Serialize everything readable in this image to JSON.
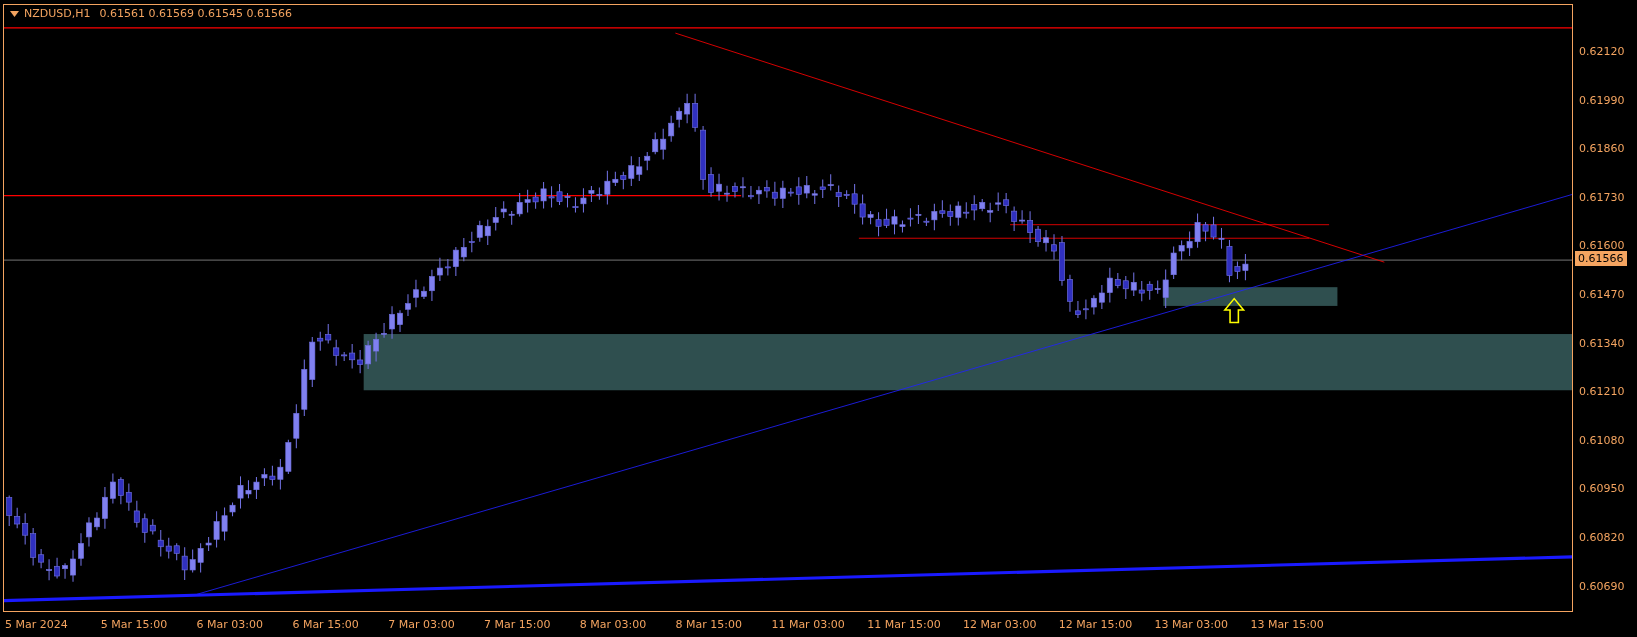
{
  "header": {
    "symbol": "NZDUSD,H1",
    "prices": [
      "0.61561",
      "0.61569",
      "0.61545",
      "0.61566"
    ]
  },
  "price_axis": {
    "labels": [
      "0.62120",
      "0.61990",
      "0.61860",
      "0.61730",
      "0.61600",
      "0.61470",
      "0.61340",
      "0.61210",
      "0.61080",
      "0.60950",
      "0.60820",
      "0.60690"
    ],
    "current_price": "0.61566"
  },
  "time_axis": {
    "labels": [
      "5 Mar 2024",
      "5 Mar 15:00",
      "6 Mar 03:00",
      "6 Mar 15:00",
      "7 Mar 03:00",
      "7 Mar 15:00",
      "8 Mar 03:00",
      "8 Mar 15:00",
      "11 Mar 03:00",
      "11 Mar 15:00",
      "12 Mar 03:00",
      "12 Mar 15:00",
      "13 Mar 03:00",
      "13 Mar 15:00"
    ]
  }
}
